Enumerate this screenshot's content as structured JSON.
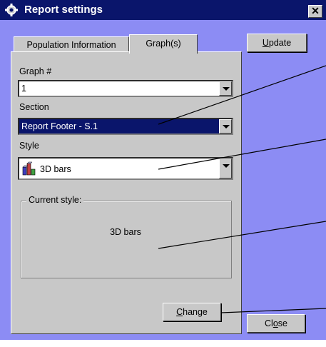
{
  "window": {
    "title": "Report settings",
    "close_glyph": "✕"
  },
  "tabs": [
    {
      "label": "Population Information",
      "selected": false
    },
    {
      "label": "Graph(s)",
      "selected": true
    }
  ],
  "form": {
    "graph_label": "Graph #",
    "graph_value": "1",
    "section_label": "Section",
    "section_value": "Report Footer - S.1",
    "style_label": "Style",
    "style_value": "3D bars",
    "style_icon": "3d-bars-chart-icon",
    "current_style_legend": "Current style:",
    "current_style_value": "3D bars"
  },
  "buttons": {
    "update_label": "Update",
    "update_mnemonic": "U",
    "change_label": "Change",
    "change_mnemonic": "C",
    "close_label": "Close",
    "close_mnemonic": "o"
  },
  "colors": {
    "window_bg": "#8c8cf4",
    "titlebar": "#0a156b",
    "panel": "#c8c8c8",
    "selection": "#0a156b"
  }
}
